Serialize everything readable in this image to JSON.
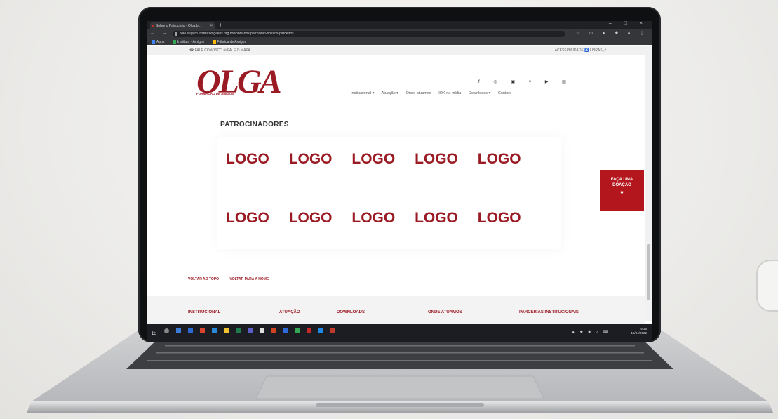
{
  "browser": {
    "tab_title": "Sobre o Patrocínio · Olga b...",
    "tab_close": "×",
    "new_tab": "+",
    "window_controls": "– □ ×",
    "nav_buttons": "← → ⟳",
    "url_prefix": "Não seguro",
    "url": "   institutoolgakos.org.br/sobre-nos/patrocinio-nossos-parceiros",
    "extensions": "☆ ⊙ ● ✚ ● ⋮",
    "bookmarks": [
      {
        "label": "Apps",
        "color": "#4285f4"
      },
      {
        "label": "Instituto · Amigos",
        "color": "#34a853"
      },
      {
        "label": "Fábrica de Amigos",
        "color": "#fbbc05"
      }
    ]
  },
  "site": {
    "topstrip_left": "☎ FALE CONOSCO   ✉ FALE O MAPA",
    "topstrip_right": "ACESSIBILIDADE ♿   LIBRAS ⤢",
    "logo_text": "OLGA",
    "logo_subtext": "FORMAÇÃO DE AMIGOS",
    "social_icons": "f ◎ ▣ ♥ ▶ ▤",
    "nav": [
      "Institucional ▾",
      "Atuação ▾",
      "Onde atuamos",
      "IOK na mídia",
      "Downloads ▾",
      "Contato"
    ],
    "section_title": "PATROCINADORES",
    "logo_rows": [
      [
        "LOGO",
        "LOGO",
        "LOGO",
        "LOGO",
        "LOGO"
      ],
      [
        "LOGO",
        "LOGO",
        "LOGO",
        "LOGO",
        "LOGO"
      ]
    ],
    "donate": {
      "line1": "FAÇA UMA",
      "line2": "DOAÇÃO",
      "heart": "♥"
    },
    "back_links": [
      "VOLTAR AO TOPO",
      "VOLTAR PARA A HOME"
    ],
    "footer_links": [
      "INSTITUCIONAL",
      "ATUAÇÃO",
      "DOWNLOADS",
      "ONDE ATUAMOS",
      "PARCERIAS INSTITUCIONAIS"
    ]
  },
  "taskbar": {
    "start": "⊞",
    "tray_icons": "▲ ◆ ◉ ♪ ⌨",
    "time": "9:35",
    "date": "15/04/2022"
  },
  "colors": {
    "brand": "#9b1b24",
    "donate": "#b3171d",
    "chrome_dark": "#202124"
  }
}
